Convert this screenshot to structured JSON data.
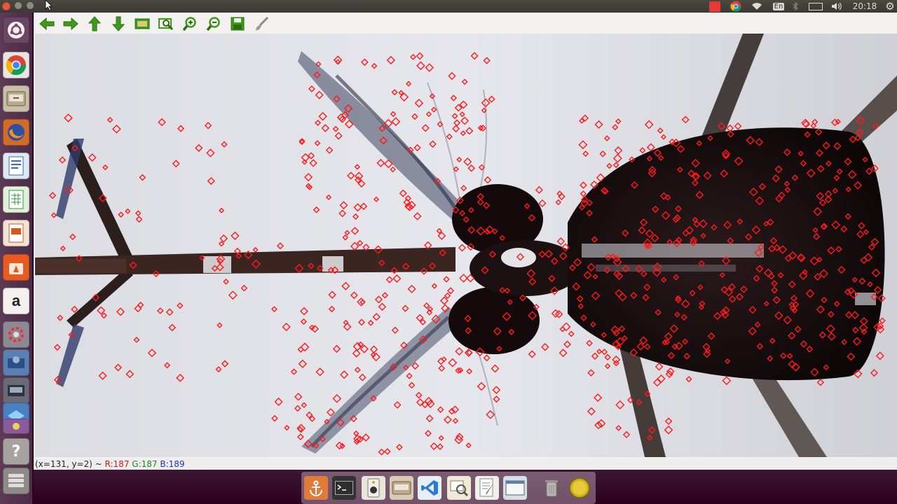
{
  "top_panel": {
    "keyboard_layout": "En",
    "clock": "20:18"
  },
  "statusbar": {
    "coords": "(x=131, y=2) ~ ",
    "r": "R:187",
    "g": "G:187",
    "b": "B:189"
  },
  "toolbar": {
    "tools": [
      "arrow-left-icon",
      "arrow-right-icon",
      "arrow-up-icon",
      "arrow-down-icon",
      "image-icon",
      "zoom-fit-icon",
      "zoom-in-icon",
      "zoom-out-icon",
      "save-icon",
      "brush-icon"
    ]
  },
  "launcher": {
    "items": [
      "ubuntu-logo-icon",
      "chrome-icon",
      "files-icon",
      "firefox-icon",
      "writer-icon",
      "calc-icon",
      "impress-icon",
      "software-center-icon",
      "amazon-icon",
      "settings-icon",
      "app-icon-1",
      "app-icon-2",
      "app-icon-3",
      "app-icon-4",
      "help-icon",
      "workspaces-icon"
    ],
    "amazon_glyph": "a"
  },
  "dock": {
    "items": [
      "anchor-icon",
      "terminal-icon",
      "speaker-icon",
      "file-manager-icon",
      "vscode-icon",
      "image-viewer-icon",
      "text-editor-icon",
      "window-icon",
      "trash-icon",
      "disc-icon"
    ]
  },
  "colors": {
    "keypoint": "#ff1a1a",
    "toolbar_icon": "#3e9a1a",
    "ubuntu_bg": "#2c001e"
  }
}
